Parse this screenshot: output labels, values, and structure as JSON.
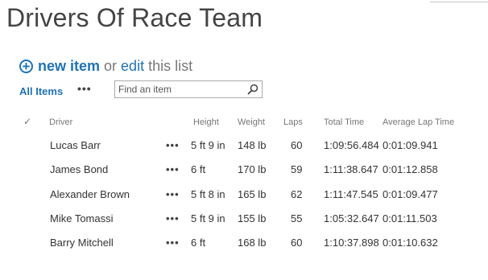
{
  "page_title": "Drivers Of Race Team",
  "header": {
    "new_item": "new item",
    "or": "or",
    "edit": "edit",
    "this_list": "this list"
  },
  "views": {
    "all_items": "All Items",
    "more": "•••"
  },
  "search": {
    "placeholder": "Find an item"
  },
  "columns": [
    "Driver",
    "Height",
    "Weight",
    "Laps",
    "Total Time",
    "Average Lap Time"
  ],
  "rows": [
    {
      "driver": "Lucas Barr",
      "height": "5 ft 9 in",
      "weight": "148 lb",
      "laps": "60",
      "total_time": "1:09:56.484",
      "avg_lap": "0:01:09.941"
    },
    {
      "driver": "James Bond",
      "height": "6 ft",
      "weight": "170 lb",
      "laps": "59",
      "total_time": "1:11:38.647",
      "avg_lap": "0:01:12.858"
    },
    {
      "driver": "Alexander Brown",
      "height": "5 ft 8 in",
      "weight": "165 lb",
      "laps": "62",
      "total_time": "1:11:47.545",
      "avg_lap": "0:01:09.477"
    },
    {
      "driver": "Mike Tomassi",
      "height": "5 ft 9 in",
      "weight": "155 lb",
      "laps": "55",
      "total_time": "1:05:32.647",
      "avg_lap": "0:01:11.503"
    },
    {
      "driver": "Barry Mitchell",
      "height": "6 ft",
      "weight": "168 lb",
      "laps": "60",
      "total_time": "1:10:37.898",
      "avg_lap": "0:01:10.632"
    }
  ],
  "row_menu": "•••",
  "colors": {
    "accent": "#1f73b7",
    "text": "#333333",
    "muted": "#777777"
  },
  "icons": {
    "add": "plus-circle-icon",
    "search": "search-icon",
    "check": "checkmark-icon"
  }
}
